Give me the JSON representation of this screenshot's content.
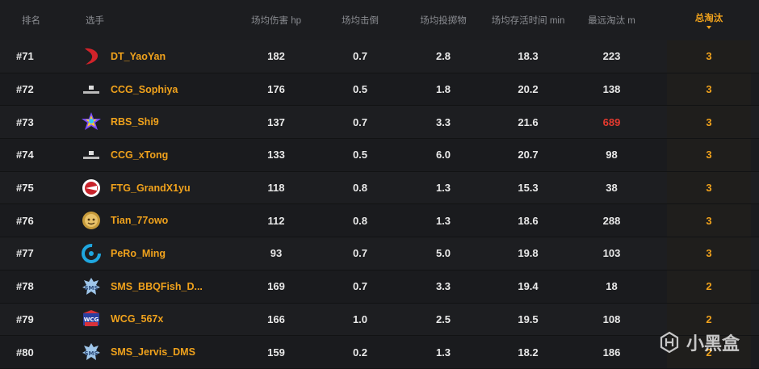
{
  "headers": {
    "rank": "排名",
    "player": "选手",
    "damage": "场均伤害 hp",
    "kills": "场均击倒",
    "throws": "场均投掷物",
    "survival": "场均存活时间 min",
    "farthest": "最远淘汰 m",
    "total": "总淘汰"
  },
  "rows": [
    {
      "rank": "#71",
      "name": "DT_YaoYan",
      "damage": "182",
      "kills": "0.7",
      "throws": "2.8",
      "survival": "18.3",
      "farthest": "223",
      "total": "3",
      "logo": "dt-team-logo"
    },
    {
      "rank": "#72",
      "name": "CCG_Sophiya",
      "damage": "176",
      "kills": "0.5",
      "throws": "1.8",
      "survival": "20.2",
      "farthest": "138",
      "total": "3",
      "logo": "ccg-team-logo"
    },
    {
      "rank": "#73",
      "name": "RBS_Shi9",
      "damage": "137",
      "kills": "0.7",
      "throws": "3.3",
      "survival": "21.6",
      "farthest": "689",
      "total": "3",
      "logo": "rbs-team-logo",
      "highlight_farthest": true
    },
    {
      "rank": "#74",
      "name": "CCG_xTong",
      "damage": "133",
      "kills": "0.5",
      "throws": "6.0",
      "survival": "20.7",
      "farthest": "98",
      "total": "3",
      "logo": "ccg-team-logo"
    },
    {
      "rank": "#75",
      "name": "FTG_GrandX1yu",
      "damage": "118",
      "kills": "0.8",
      "throws": "1.3",
      "survival": "15.3",
      "farthest": "38",
      "total": "3",
      "logo": "ftg-team-logo"
    },
    {
      "rank": "#76",
      "name": "Tian_77owo",
      "damage": "112",
      "kills": "0.8",
      "throws": "1.3",
      "survival": "18.6",
      "farthest": "288",
      "total": "3",
      "logo": "tian-team-logo"
    },
    {
      "rank": "#77",
      "name": "PeRo_Ming",
      "damage": "93",
      "kills": "0.7",
      "throws": "5.0",
      "survival": "19.8",
      "farthest": "103",
      "total": "3",
      "logo": "pero-team-logo"
    },
    {
      "rank": "#78",
      "name": "SMS_BBQFish_D...",
      "damage": "169",
      "kills": "0.7",
      "throws": "3.3",
      "survival": "19.4",
      "farthest": "18",
      "total": "2",
      "logo": "sms-team-logo"
    },
    {
      "rank": "#79",
      "name": "WCG_567x",
      "damage": "166",
      "kills": "1.0",
      "throws": "2.5",
      "survival": "19.5",
      "farthest": "108",
      "total": "2",
      "logo": "wcg-team-logo"
    },
    {
      "rank": "#80",
      "name": "SMS_Jervis_DMS",
      "damage": "159",
      "kills": "0.2",
      "throws": "1.3",
      "survival": "18.2",
      "farthest": "186",
      "total": "2",
      "logo": "sms-team-logo"
    }
  ],
  "colors": {
    "accent": "#f0a21c",
    "highlight": "#e53a2f",
    "background": "#18191b"
  },
  "watermark": {
    "text": "小黑盒"
  }
}
